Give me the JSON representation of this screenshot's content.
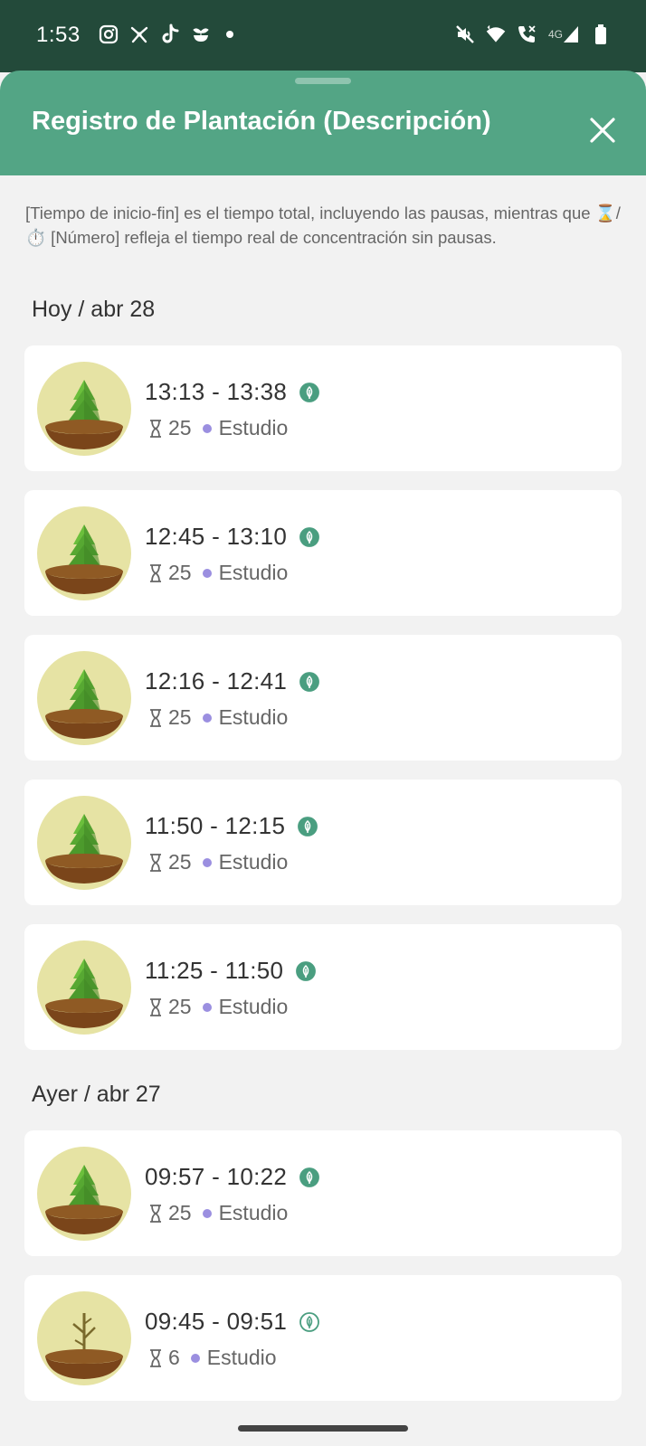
{
  "status": {
    "time": "1:53",
    "left_icons": [
      "instagram-icon",
      "pinwheel-icon",
      "tiktok-icon",
      "sprout-icon"
    ],
    "right_icons": [
      "mute-icon",
      "wifi-icon",
      "call-icon",
      "signal-icon",
      "battery-icon"
    ],
    "network": "4G"
  },
  "header": {
    "title": "Registro de Plantación (Descripción)"
  },
  "description": "[Tiempo de inicio-fin] es el tiempo total, incluyendo las pausas, mientras que ⌛/⏱️ [Número] refleja el tiempo real de concentración sin pausas.",
  "colors": {
    "header": "#53a585",
    "status_bar": "#234a3a",
    "tag_study": "#9b8fe0",
    "leaf": "#4a9e80"
  },
  "sections": [
    {
      "label": "Hoy / abr 28",
      "entries": [
        {
          "time": "13:13 - 13:38",
          "duration": "25",
          "tag": "Estudio",
          "tree": "alive"
        },
        {
          "time": "12:45 - 13:10",
          "duration": "25",
          "tag": "Estudio",
          "tree": "alive"
        },
        {
          "time": "12:16 - 12:41",
          "duration": "25",
          "tag": "Estudio",
          "tree": "alive"
        },
        {
          "time": "11:50 - 12:15",
          "duration": "25",
          "tag": "Estudio",
          "tree": "alive"
        },
        {
          "time": "11:25 - 11:50",
          "duration": "25",
          "tag": "Estudio",
          "tree": "alive"
        }
      ]
    },
    {
      "label": "Ayer / abr 27",
      "entries": [
        {
          "time": "09:57 - 10:22",
          "duration": "25",
          "tag": "Estudio",
          "tree": "alive"
        },
        {
          "time": "09:45 - 09:51",
          "duration": "6",
          "tag": "Estudio",
          "tree": "withered"
        }
      ]
    }
  ]
}
